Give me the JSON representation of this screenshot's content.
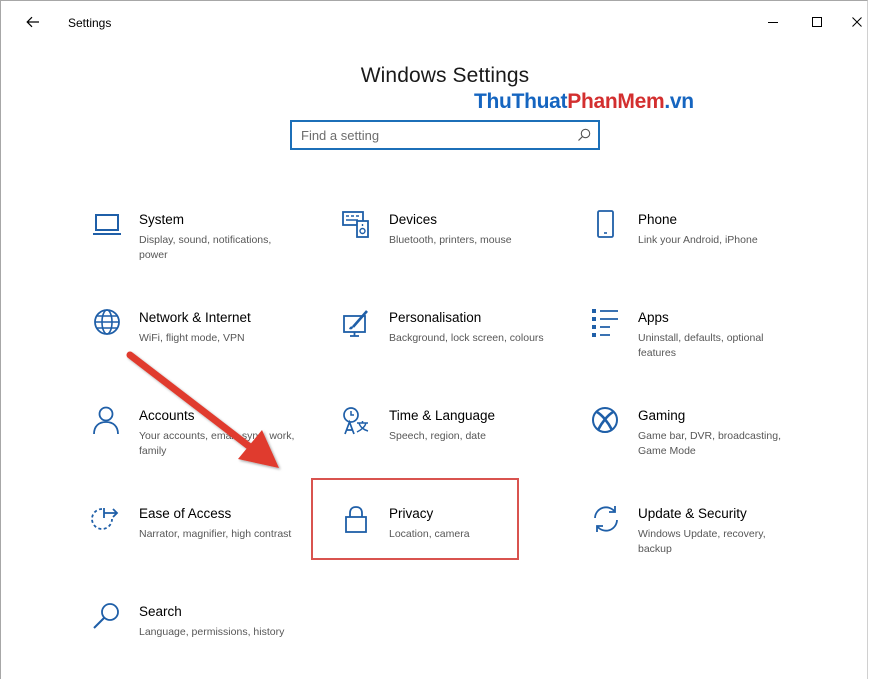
{
  "window": {
    "title": "Settings",
    "back_icon": "back-arrow-icon",
    "controls": [
      "minimize-icon",
      "maximize-icon",
      "close-icon"
    ]
  },
  "heading": "Windows Settings",
  "watermark": {
    "part1": "ThuThuat",
    "part2": "PhanMem",
    "part3": ".vn"
  },
  "search": {
    "placeholder": "Find a setting",
    "value": "",
    "icon": "search-icon"
  },
  "tiles": [
    {
      "title": "System",
      "desc": "Display, sound, notifications, power",
      "icon": "laptop-icon"
    },
    {
      "title": "Devices",
      "desc": "Bluetooth, printers, mouse",
      "icon": "devices-icon"
    },
    {
      "title": "Phone",
      "desc": "Link your Android, iPhone",
      "icon": "phone-icon"
    },
    {
      "title": "Network & Internet",
      "desc": "WiFi, flight mode, VPN",
      "icon": "globe-icon"
    },
    {
      "title": "Personalisation",
      "desc": "Background, lock screen, colours",
      "icon": "paintbrush-icon"
    },
    {
      "title": "Apps",
      "desc": "Uninstall, defaults, optional features",
      "icon": "apps-list-icon"
    },
    {
      "title": "Accounts",
      "desc": "Your accounts, email, sync, work, family",
      "icon": "person-icon"
    },
    {
      "title": "Time & Language",
      "desc": "Speech, region, date",
      "icon": "time-language-icon"
    },
    {
      "title": "Gaming",
      "desc": "Game bar, DVR, broadcasting, Game Mode",
      "icon": "xbox-icon"
    },
    {
      "title": "Ease of Access",
      "desc": "Narrator, magnifier, high contrast",
      "icon": "ease-of-access-icon"
    },
    {
      "title": "Privacy",
      "desc": "Location, camera",
      "icon": "lock-icon"
    },
    {
      "title": "Update & Security",
      "desc": "Windows Update, recovery, backup",
      "icon": "sync-arrows-icon"
    },
    {
      "title": "Search",
      "desc": "Language, permissions, history",
      "icon": "search-icon"
    }
  ],
  "colors": {
    "accent": "#1c6fb8",
    "icon_blue": "#1f5fa8",
    "annotation_red": "#d9534f",
    "watermark_blue": "#1565c0",
    "watermark_red": "#d32f2f"
  },
  "annotation": {
    "highlighted_tile": "Privacy"
  }
}
